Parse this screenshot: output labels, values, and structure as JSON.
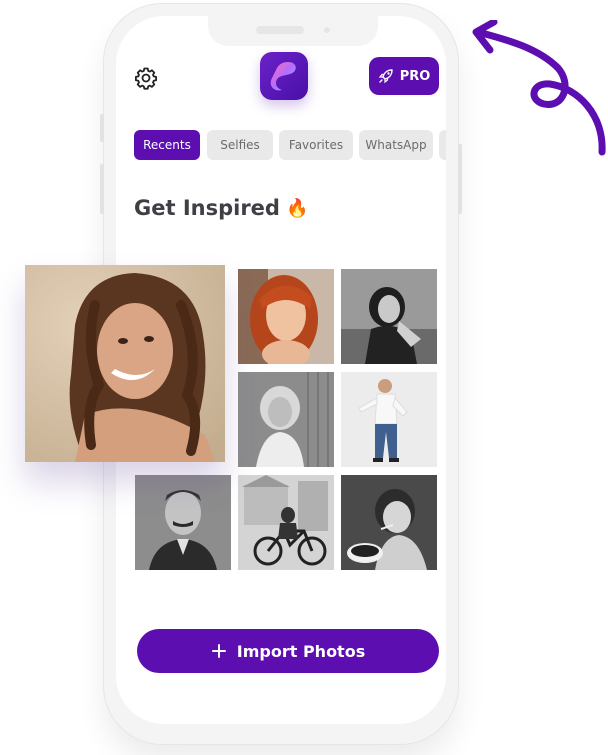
{
  "header": {
    "settings_icon": "gear-icon",
    "app_logo": "app-logo",
    "pro_label": "PRO",
    "pro_icon": "rocket-icon"
  },
  "tabs": [
    {
      "label": "Recents",
      "active": true
    },
    {
      "label": "Selfies",
      "active": false
    },
    {
      "label": "Favorites",
      "active": false
    },
    {
      "label": "WhatsApp",
      "active": false
    }
  ],
  "section": {
    "title": "Get Inspired",
    "emoji": "🔥"
  },
  "gallery": {
    "items": [
      {
        "name": "portrait-redhead",
        "mode": "color"
      },
      {
        "name": "portrait-bw-woman",
        "mode": "bw"
      },
      {
        "name": "portrait-bw-blonde",
        "mode": "bw"
      },
      {
        "name": "portrait-man-pointing",
        "mode": "color"
      },
      {
        "name": "portrait-vintage-man",
        "mode": "bw"
      },
      {
        "name": "vintage-motorcycle",
        "mode": "bw"
      },
      {
        "name": "vintage-child",
        "mode": "bw"
      }
    ],
    "featured": {
      "name": "featured-curly-woman"
    }
  },
  "footer": {
    "import_label": "Import Photos",
    "import_icon": "plus-icon"
  },
  "colors": {
    "accent": "#5d0eb0",
    "tab_bg": "#e9e9ea"
  }
}
